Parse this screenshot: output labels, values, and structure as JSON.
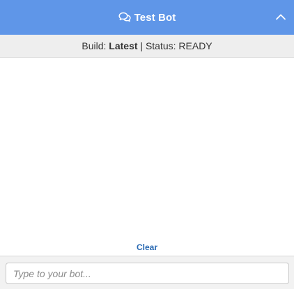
{
  "header": {
    "title": "Test Bot",
    "icon": "chat-bubbles-icon",
    "collapse_icon": "chevron-up-icon",
    "background_color": "#5f96e8"
  },
  "status_bar": {
    "build_label": "Build: ",
    "build_value": "Latest",
    "separator": " | ",
    "status_label": "Status: ",
    "status_value": "READY"
  },
  "messages": [],
  "actions": {
    "clear_label": "Clear"
  },
  "composer": {
    "placeholder": "Type to your bot...",
    "value": ""
  }
}
